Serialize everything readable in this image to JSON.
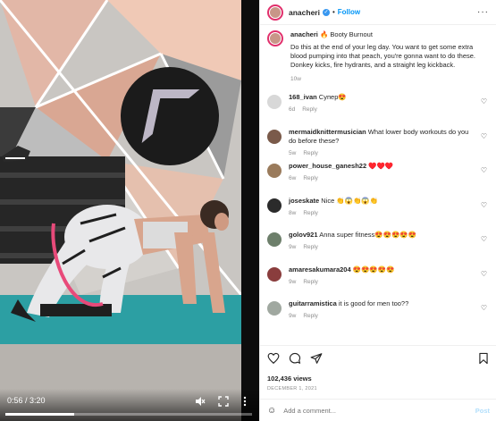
{
  "video": {
    "time": "0:56 / 3:20",
    "progress_fraction": 0.28,
    "colors": {
      "mat": "#2c9fa3",
      "wall": "#c9c6c2",
      "floor": "#b7b3ae"
    }
  },
  "header": {
    "username": "anacheri",
    "follow_label": "Follow",
    "separator": "•",
    "more_label": "···"
  },
  "caption": {
    "username": "anacheri",
    "emoji": "🔥",
    "title": "Booty Burnout",
    "text": "Do this at the end of your leg day. You want to get some extra blood pumping into that peach, you're gonna want to do these. Donkey kicks, fire hydrants, and a straight leg kickback.",
    "age": "10w"
  },
  "comments": [
    {
      "username": "168_ivan",
      "text": "Супер😍",
      "age": "6d",
      "reply_label": "Reply",
      "avatar_color": "#d8d8d8"
    },
    {
      "username": "mermaidknittermusician",
      "text": "What lower body workouts do you do before these?",
      "age": "5w",
      "reply_label": "Reply",
      "avatar_color": "#7a5a4a"
    },
    {
      "username": "power_house_ganesh22",
      "text": "♥️♥️♥️",
      "age": "6w",
      "reply_label": "Reply",
      "avatar_color": "#9a7b5c"
    },
    {
      "username": "joseskate",
      "text": "Nice 👏😱👏😱👏",
      "age": "8w",
      "reply_label": "Reply",
      "avatar_color": "#2b2b2b"
    },
    {
      "username": "golov921",
      "text": "Anna super fitness😍😍😍😍😍",
      "age": "9w",
      "reply_label": "Reply",
      "avatar_color": "#6d7f6b"
    },
    {
      "username": "amaresakumara204",
      "text": "😍😍😍😍😍",
      "age": "9w",
      "reply_label": "Reply",
      "avatar_color": "#8a3d3d"
    },
    {
      "username": "guitarramistica",
      "text": "it is good for men too??",
      "age": "9w",
      "reply_label": "Reply",
      "avatar_color": "#a0a8a0"
    }
  ],
  "actions": {
    "views": "102,436 views",
    "date": "DECEMBER 1, 2021"
  },
  "add_comment": {
    "emoji": "☺",
    "placeholder": "Add a comment...",
    "post_label": "Post"
  },
  "colors": {
    "accent": "#0095f6",
    "verified": "#3897f0",
    "meta": "#8e8e8e"
  }
}
